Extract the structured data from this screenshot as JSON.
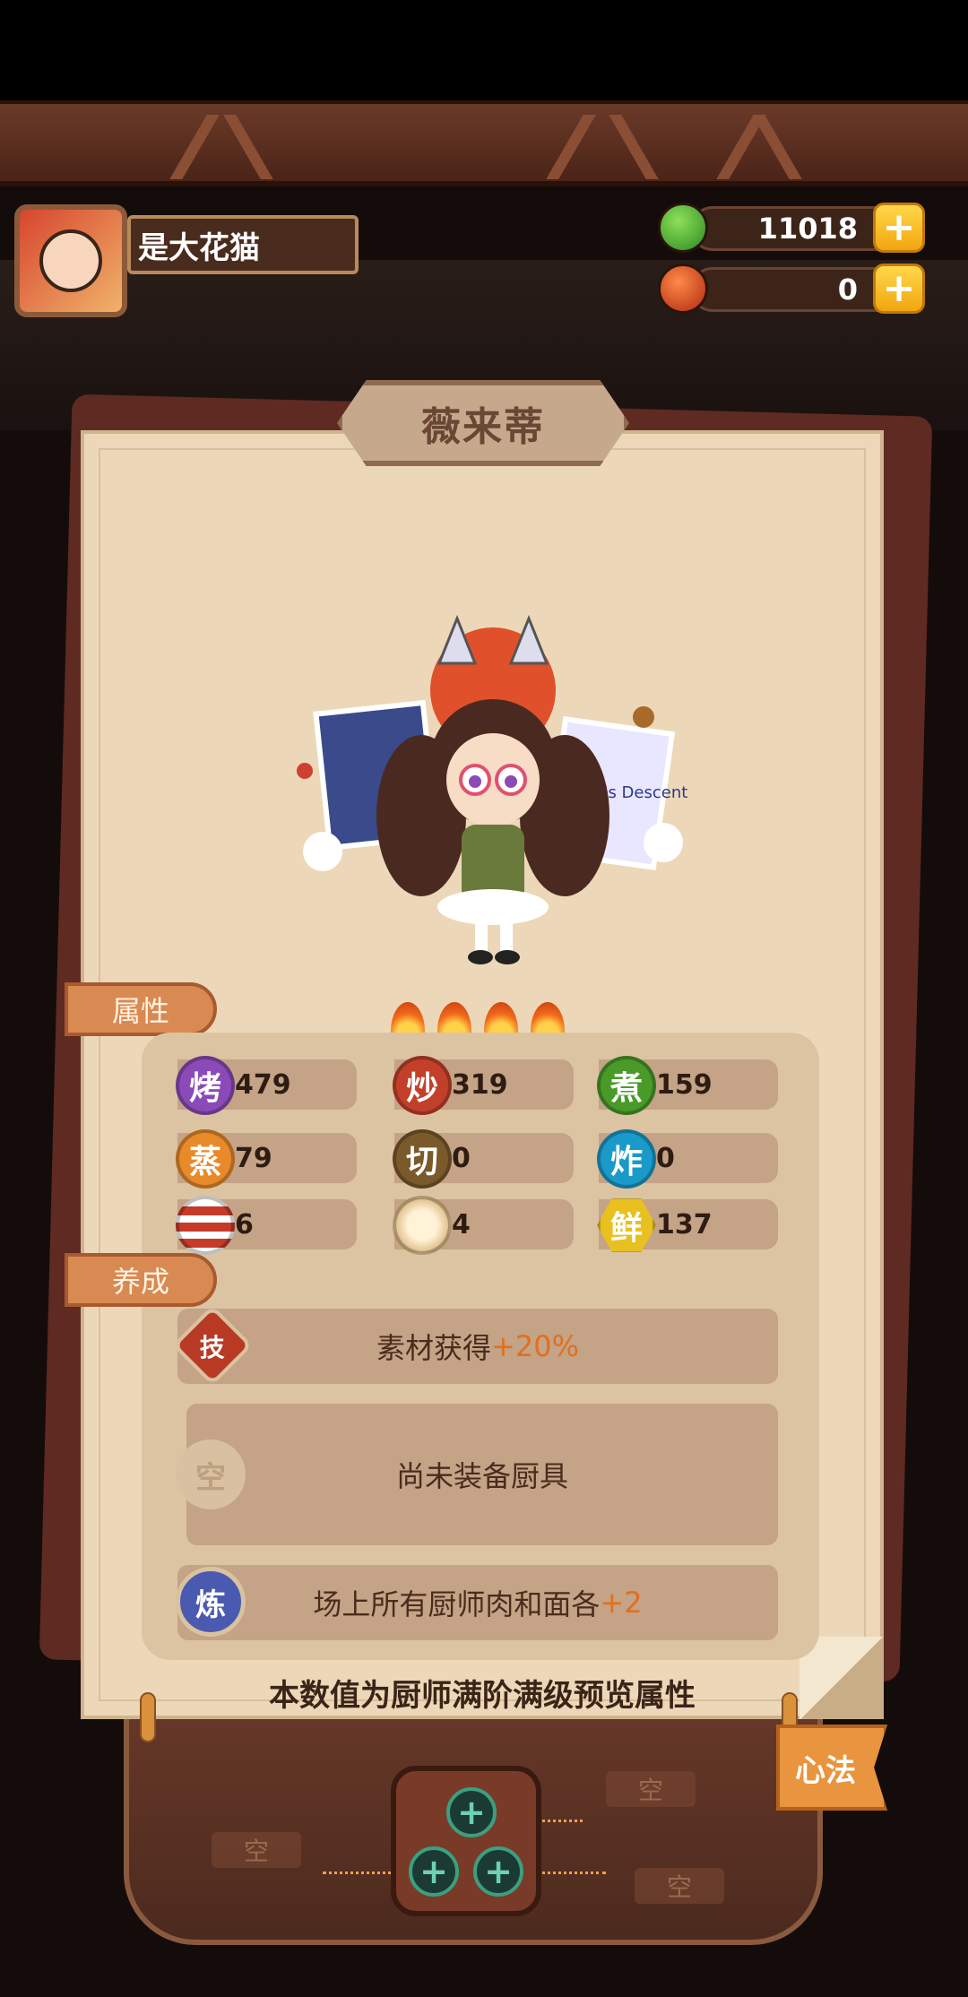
{
  "player": {
    "name": "是大花猫"
  },
  "currency": {
    "jade": {
      "value": "11018",
      "plus": "+"
    },
    "ruby": {
      "value": "0",
      "plus": "+"
    }
  },
  "chef": {
    "name": "薇来蒂",
    "art_caption": "Frost's Descent"
  },
  "sections": {
    "attributes": "属性",
    "cultivation": "养成"
  },
  "stats": [
    {
      "label": "烤",
      "value": "479",
      "color": "#8a4ab8"
    },
    {
      "label": "炒",
      "value": "319",
      "color": "#c2402a"
    },
    {
      "label": "煮",
      "value": "159",
      "color": "#4a9a2a"
    },
    {
      "label": "蒸",
      "value": "79",
      "color": "#e88a2a"
    },
    {
      "label": "切",
      "value": "0",
      "color": "#7a5a2a"
    },
    {
      "label": "炸",
      "value": "0",
      "color": "#1a9ac8"
    },
    {
      "label": "",
      "value": "6",
      "color": "#c63a2a",
      "icon": "meat-icon"
    },
    {
      "label": "",
      "value": "4",
      "color": "#e8c68a",
      "icon": "bun-icon"
    },
    {
      "label": "鲜",
      "value": "137",
      "color": "#e8c020",
      "icon": "hex-icon"
    }
  ],
  "cultivation": {
    "skill": {
      "icon_text": "技",
      "text": "素材获得",
      "bonus": "+20%"
    },
    "equipment": {
      "icon_text": "空",
      "text": "尚未装备厨具"
    },
    "refine": {
      "icon_text": "炼",
      "text": "场上所有厨师肉和面各",
      "bonus": "+2"
    }
  },
  "footer_note": "本数值为厨师满阶满级预览属性",
  "xinfa": {
    "label": "心法"
  },
  "slots": {
    "empty": "空"
  },
  "colors": {
    "accent": "#e0701f",
    "paper": "#ecd8b8"
  }
}
